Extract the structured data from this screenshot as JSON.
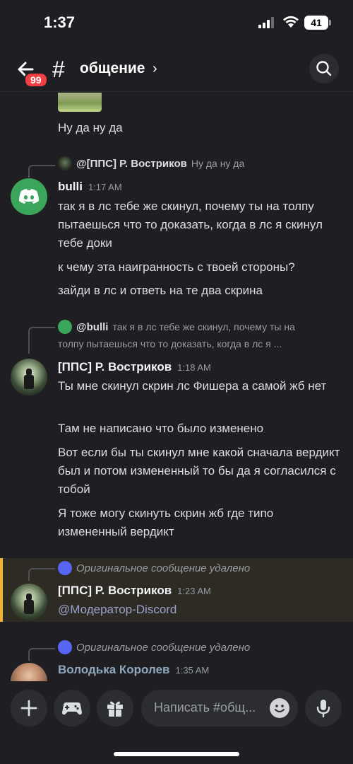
{
  "status_bar": {
    "time": "1:37",
    "battery": "41"
  },
  "header": {
    "badge": "99",
    "channel_name": "общение"
  },
  "messages": {
    "top_text": "Ну да ну да",
    "msg1": {
      "reply_author": "@[ППС] Р. Востриков",
      "reply_text": "Ну да ну да",
      "author": "bulli",
      "time": "1:17 AM",
      "lines": [
        "так я в лс тебе же скинул, почему ты на толпу пытаешься что то доказать, когда в лс я скинул тебе доки",
        "к чему эта наигранность с твоей стороны?",
        "зайди в лс и ответь на те два скрина"
      ]
    },
    "msg2": {
      "reply_author": "@bulli",
      "reply_text_1": "так я в лс тебе же скинул, почему ты на",
      "reply_text_2": "толпу пытаешься что то доказать, когда в лс я ...",
      "author": "[ППС] Р. Востриков",
      "time": "1:18 AM",
      "lines": [
        "Ты мне скинул скрин лс Фишера а самой жб нет",
        "Там не написано что было изменено",
        "Вот если бы ты скинул мне какой сначала вердикт был и потом измененный то бы да я согласился с тобой",
        "Я тоже  могу скинуть скрин жб где типо измененный вердикт"
      ]
    },
    "msg3": {
      "reply_deleted": "Оригинальное сообщение удалено",
      "author": "[ППС] Р. Востриков",
      "time": "1:23 AM",
      "text": "@Модератор-Discord"
    },
    "msg4": {
      "reply_deleted": "Оригинальное сообщение удалено",
      "author": "Володька Королев",
      "time": "1:35 AM"
    }
  },
  "composer": {
    "placeholder": "Написать #общ..."
  },
  "colors": {
    "background": "#1f1f23",
    "discord_green": "#3ba55c",
    "discord_blurple": "#5865f2",
    "mention_highlight": "#f0b232",
    "badge_red": "#f23f43"
  },
  "icons": [
    "back-arrow-icon",
    "hash-icon",
    "chevron-right-icon",
    "search-icon",
    "discord-logo-icon",
    "plus-icon",
    "gamepad-icon",
    "gift-icon",
    "emoji-icon",
    "microphone-icon"
  ]
}
